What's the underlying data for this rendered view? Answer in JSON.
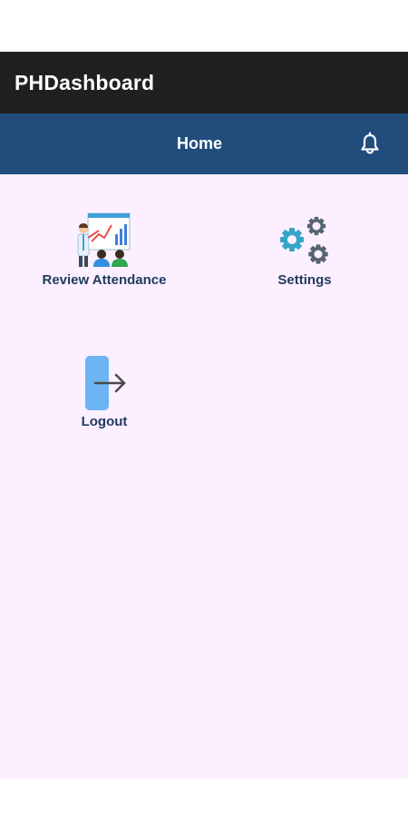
{
  "app": {
    "title": "PHDashboard"
  },
  "nav": {
    "title": "Home",
    "notification_icon": "bell-icon"
  },
  "tiles": [
    {
      "label": "Review Attendance",
      "icon": "presentation-icon"
    },
    {
      "label": "Settings",
      "icon": "gears-icon"
    },
    {
      "label": "Logout",
      "icon": "logout-icon"
    }
  ],
  "colors": {
    "app_bar": "#202020",
    "nav_bar": "#214d7c",
    "content_bg": "#fcefff",
    "label": "#1f3b5e"
  }
}
